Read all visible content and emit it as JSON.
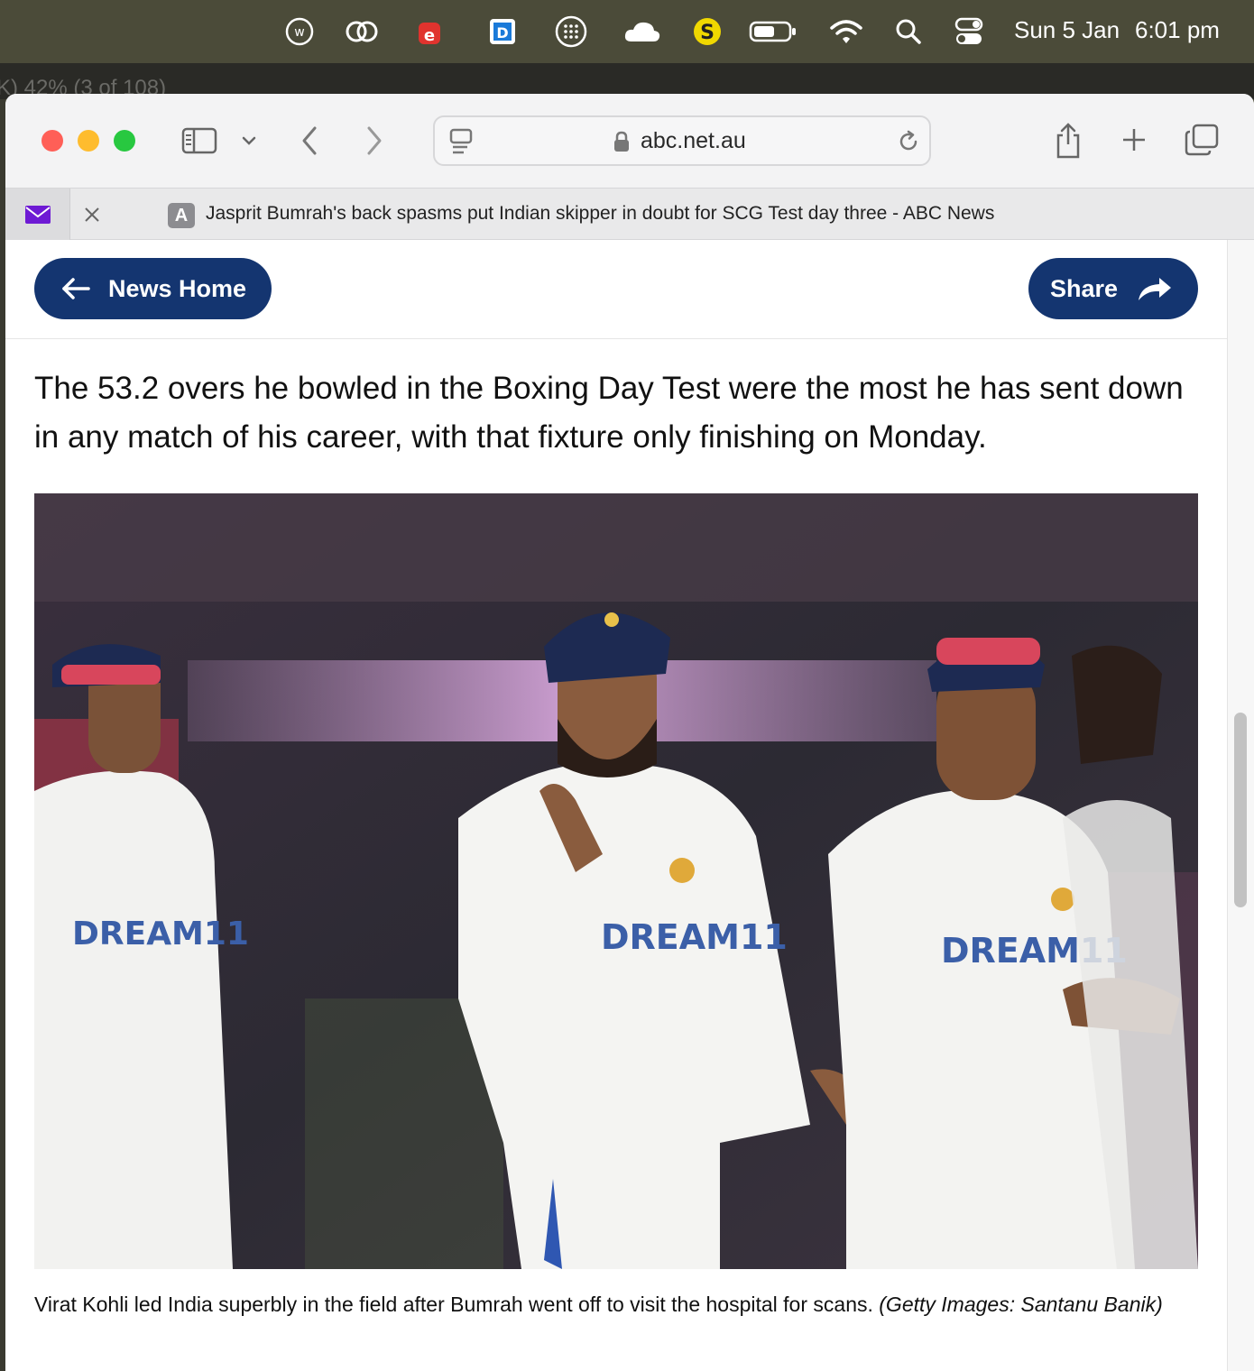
{
  "menubar": {
    "date": "Sun 5 Jan",
    "time": "6:01 pm",
    "icons": [
      "w-circle-icon",
      "creative-cloud-icon",
      "e-app-icon",
      "dashlane-icon",
      "grid-dots-icon",
      "cloud-icon",
      "s-app-icon",
      "battery-icon",
      "wifi-icon",
      "spotlight-search-icon",
      "control-center-icon"
    ]
  },
  "behind_window": {
    "text": "K) 42% (3 of 108)"
  },
  "browser": {
    "url": "abc.net.au",
    "tab": {
      "favicon_letter": "A",
      "title": "Jasprit Bumrah's back spasms put Indian skipper in doubt for SCG Test day three - ABC News"
    },
    "colors": {
      "close": "#ff5f57",
      "minimize": "#febc2e",
      "zoom": "#28c840"
    }
  },
  "page": {
    "news_home_label": "News Home",
    "share_label": "Share",
    "accent": "#143570",
    "paragraph": "The 53.2 overs he bowled in the Boxing Day Test were the most he has sent down in any match of his career, with that fixture only finishing on Monday.",
    "caption": "Virat Kohli led India superbly in the field after Bumrah went off to visit the hospital for scans.",
    "credit": "(Getty Images: Santanu Banik)",
    "jersey_text": "DREAM11"
  }
}
